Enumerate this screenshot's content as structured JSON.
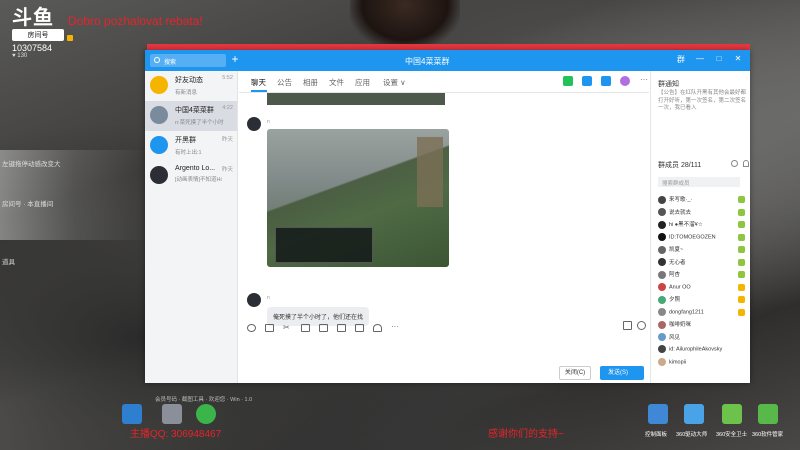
{
  "stream": {
    "logo_text": "斗鱼",
    "badge": "房间号",
    "room_id": "10307584",
    "fans": "130",
    "title": "Dobro pozhalovat rebata!"
  },
  "overlay_left": [
    "左键拖停动感改变大",
    "房间号 · 本直播间",
    "道具"
  ],
  "window": {
    "title": "中国4菜菜群",
    "search_placeholder": "搜索",
    "controls": [
      "群",
      "—",
      "□",
      "✕"
    ]
  },
  "conversations": [
    {
      "name": "好友动态",
      "time": "5:52",
      "msg": "有新消息",
      "color": "#f5b400"
    },
    {
      "name": "中国4菜菜群",
      "time": "4:22",
      "msg": "n:菜死摸了半个小时",
      "color": "#7b8b9e"
    },
    {
      "name": "开黑群",
      "time": "昨天",
      "msg": "有时上出:1",
      "color": "#1e95ee"
    },
    {
      "name": "Argento Lo...",
      "time": "昨天",
      "msg": "[动画表情]不知道Hi",
      "color": "#2b2f35"
    }
  ],
  "tabs": [
    "聊天",
    "公告",
    "相册",
    "文件",
    "应用",
    "设置 ∨"
  ],
  "messages": {
    "sender": "n",
    "text": "俺死摸了半个小时了，他们还在找"
  },
  "buttons": {
    "close": "关闭(C)",
    "send": "发送(S)"
  },
  "notice": {
    "title": "群通知",
    "text": "【公告】在红队开黑有其他会最好都打开好听，第一次签名，第二次签名一次，我已看入"
  },
  "members": {
    "title": "群成员 28/111",
    "search_placeholder": "搜索群成员",
    "list": [
      {
        "name": "来写歌·_·",
        "color": "#444",
        "badge": "#8ec63f"
      },
      {
        "name": "说去就去",
        "color": "#555",
        "badge": "#8ec63f"
      },
      {
        "name": "hi ●黑不溜¥☆",
        "color": "#222",
        "badge": "#8ec63f"
      },
      {
        "name": "ID:TOMOEGOZEN",
        "color": "#111",
        "badge": "#8ec63f"
      },
      {
        "name": "凯夏~",
        "color": "#666",
        "badge": "#8ec63f"
      },
      {
        "name": "无心者",
        "color": "#333",
        "badge": "#8ec63f"
      },
      {
        "name": "阿杏",
        "color": "#777",
        "badge": "#8ec63f"
      },
      {
        "name": "Anur  OO",
        "color": "#c44",
        "badge": "#f5b400"
      },
      {
        "name": "夕照",
        "color": "#4a7",
        "badge": "#f5b400"
      },
      {
        "name": "dongfang1211",
        "color": "#888",
        "badge": "#f5b400"
      },
      {
        "name": "咖啡奶咪",
        "color": "#a66",
        "badge": ""
      },
      {
        "name": "风见",
        "color": "#69c",
        "badge": ""
      },
      {
        "name": "id: AilurophileAkovsky",
        "color": "#444",
        "badge": ""
      },
      {
        "name": "kimopii",
        "color": "#ca8",
        "badge": ""
      }
    ]
  },
  "desktop": {
    "promo_left": "主播QQ: 306948467",
    "promo_right": "感谢你们的支持~",
    "icons": [
      "控制面板",
      "360驱动大师",
      "360安全卫士",
      "360软件管家"
    ],
    "status_row": "会员号码 · 截图工具 · 欢迎您 · Win · 1.0"
  }
}
